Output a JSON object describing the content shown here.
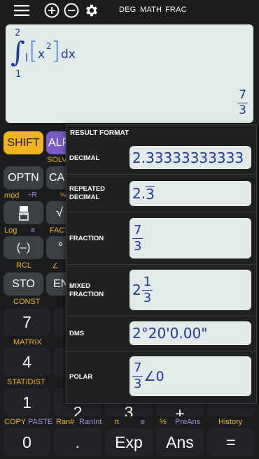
{
  "topbar": {
    "menu_icon": "hamburger-menu-icon",
    "add_icon": "plus-circle-icon",
    "remove_icon": "minus-circle-icon",
    "settings_icon": "gear-icon",
    "angle_mode": "DEG",
    "input_mode": "MATH",
    "output_mode": "FRAC"
  },
  "display": {
    "upper": "2",
    "lower": "1",
    "integrand_base": "x",
    "integrand_exp": "2",
    "dx": "dx",
    "result_num": "7",
    "result_den": "3"
  },
  "popup": {
    "title": "RESULT FORMAT",
    "options": [
      {
        "label": "DECIMAL",
        "value": "2.33333333333"
      },
      {
        "label": "REPEATED DECIMAL",
        "value_whole": "2.",
        "value_repeat": "3"
      },
      {
        "label": "FRACTION",
        "num": "7",
        "den": "3"
      },
      {
        "label": "MIXED FRACTION",
        "whole": "2",
        "num": "1",
        "den": "3"
      },
      {
        "label": "DMS",
        "value": "2°20'0.00\""
      },
      {
        "label": "POLAR",
        "num": "7",
        "den": "3",
        "angle": "∠0"
      }
    ]
  },
  "keys": {
    "shift": "SHIFT",
    "alpha": "ALP",
    "optn": "OPTN",
    "calc": "CA",
    "neg": "(–)",
    "deg": "°",
    "sto": "STO",
    "eng": "EN",
    "seven": "7",
    "four": "4",
    "one": "1",
    "two": "2",
    "three": "3",
    "plus": "+",
    "zero": "0",
    "dot": ".",
    "exp": "Exp",
    "ans": "Ans",
    "equals": "="
  },
  "labels": {
    "solve": "SOLV",
    "mod": "mod",
    "divr": "÷R",
    "pct_small": "%",
    "log": "Log",
    "a": "a",
    "fact": "FACT",
    "rcl": "RCL",
    "angle": "∠",
    "const": "CONST",
    "matrix": "MATRIX",
    "statdist": "STAT/DIST",
    "copy": "COPY",
    "paste": "PASTE",
    "ran": "Ran#",
    "ranint": "RanInt",
    "pi": "π",
    "e": "e",
    "percent": "%",
    "preans": "PreAns",
    "history": "History"
  }
}
